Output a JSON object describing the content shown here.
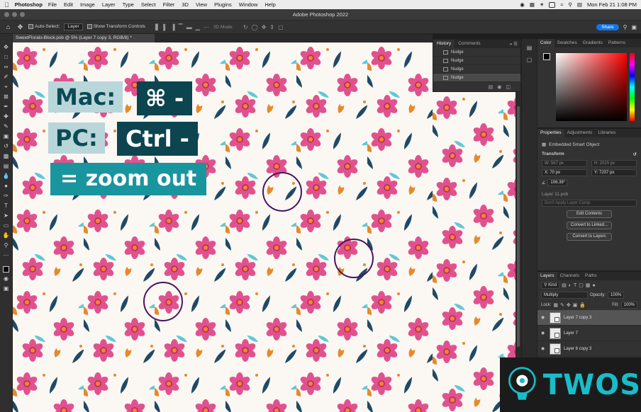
{
  "menubar": {
    "app": "Photoshop",
    "items": [
      "File",
      "Edit",
      "Image",
      "Layer",
      "Type",
      "Select",
      "Filter",
      "3D",
      "View",
      "Plugins",
      "Window",
      "Help"
    ],
    "clock": "Mon Feb 21  1:08 PM"
  },
  "window": {
    "title": "Adobe Photoshop 2022"
  },
  "options": {
    "auto_select_label": "Auto-Select:",
    "auto_select_value": "Layer",
    "transform_label": "Show Transform Controls",
    "mode_3d": "3D Mode:",
    "share_label": "Share"
  },
  "document": {
    "tab_title": "SweetFlorals-Block.psb @ 5% (Layer 7 copy 3, RGB/8) *"
  },
  "overlay": {
    "mac_label": "Mac:",
    "mac_keys": "⌘ -",
    "pc_label": "PC:",
    "pc_keys": "Ctrl -",
    "action": "= zoom out"
  },
  "history": {
    "tabs": [
      "History",
      "Comments"
    ],
    "items": [
      "Nudge",
      "Nudge",
      "Nudge",
      "Nudge"
    ]
  },
  "color_panel": {
    "tabs": [
      "Color",
      "Swatches",
      "Gradients",
      "Patterns"
    ]
  },
  "properties": {
    "tabs": [
      "Properties",
      "Adjustments",
      "Libraries"
    ],
    "object_type": "Embedded Smart Object",
    "transform_title": "Transform",
    "w": "W: 567 px",
    "h": "H: 2020 px",
    "x": "X: 70 px",
    "y": "Y: 7237 px",
    "angle": "106.39°",
    "source": "Layer 11.psb",
    "layer_comp": "Don't Apply Layer Comp",
    "buttons": [
      "Edit Contents",
      "Convert to Linked...",
      "Convert to Layers"
    ]
  },
  "layers": {
    "tabs": [
      "Layers",
      "Channels",
      "Paths"
    ],
    "kind": "Kind",
    "blend": "Multiply",
    "opacity_label": "Opacity:",
    "opacity": "100%",
    "lock_label": "Lock:",
    "fill_label": "Fill:",
    "fill": "100%",
    "items": [
      "Layer 7 copy 3",
      "Layer 7",
      "Layer 6 copy 3"
    ]
  },
  "watermark": {
    "text": "TWOS"
  },
  "colors": {
    "accent": "#1473e6",
    "label_light": "#b9d6da",
    "label_dark": "#0c4450",
    "label_teal": "#19959e",
    "circle": "#4a1460",
    "watermark_text": "#19bcc9"
  }
}
